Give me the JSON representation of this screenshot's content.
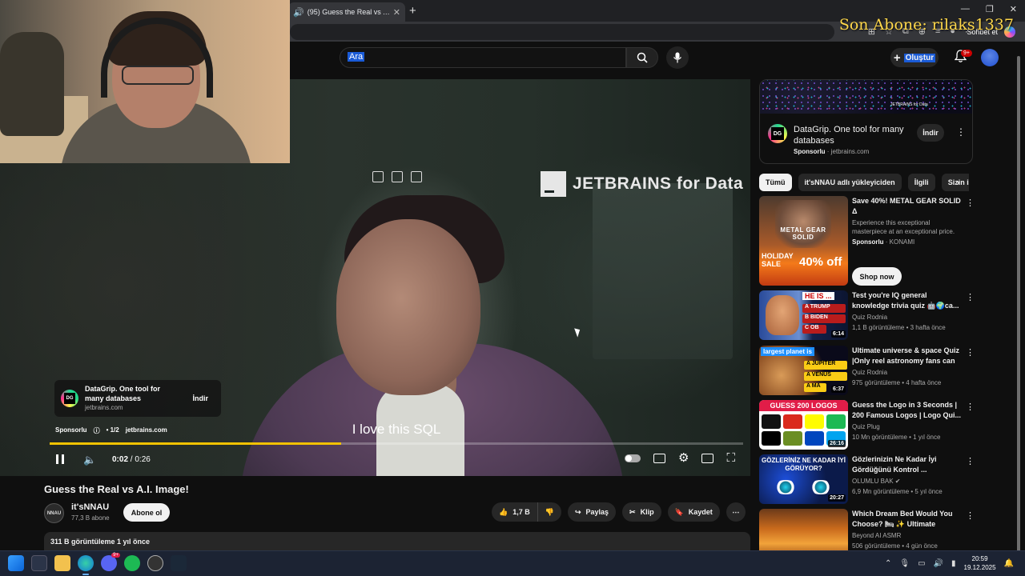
{
  "browser": {
    "tab_title": "(95) Guess the Real vs A.I. Image!",
    "sohbet_label": "Sohbet et",
    "overlay_text": "Son Abone: rilaks1337"
  },
  "header": {
    "search_placeholder": "Ara",
    "create_label": "Oluştur",
    "notif_count": "9+"
  },
  "player": {
    "brand_text": "JETBRAINS for Data",
    "subtitle": "I love this SQL",
    "ad": {
      "logo": "DG",
      "title": "DataGrip. One tool for many databases",
      "domain": "jetbrains.com",
      "button": "İndir"
    },
    "sponsor": {
      "label": "Sponsorlu",
      "count": "• 1/2",
      "domain": "jetbrains.com"
    },
    "time_current": "0:02",
    "time_total": "/ 0:26",
    "progress": 0.42
  },
  "video": {
    "title": "Guess the Real vs A.I. Image!",
    "channel_avatar": "NNAU",
    "channel": "it'sNNAU",
    "subs": "77,3 B abone",
    "subscribe": "Abone ol",
    "likes": "1,7 B",
    "share": "Paylaş",
    "clip": "Klip",
    "save": "Kaydet",
    "views_line": "311 B görüntüleme  1 yıl önce"
  },
  "side_ad": {
    "brand_small": "JETBRAINS for Data",
    "logo": "DG",
    "title": "DataGrip. One tool for many databases",
    "sponsor": "Sponsorlu",
    "domain": "· jetbrains.com",
    "button": "İndir"
  },
  "chips": [
    "Tümü",
    "it'sNNAU adlı yükleyiciden",
    "İlgili",
    "Sizin için"
  ],
  "rec_ad": {
    "title": "Save 40%! METAL GEAR SOLID Δ",
    "desc": "Experience this exceptional masterpiece at an exceptional price.",
    "sponsor": "Sponsorlu",
    "advertiser": "· KONAMI",
    "button": "Shop now",
    "thumb_title": "METAL GEAR SOLID",
    "thumb_sale": "HOLIDAY SALE",
    "thumb_pct": "40% off"
  },
  "recommendations": [
    {
      "title": "Test you're IQ general knowledge trivia quiz 🤖🌍ca...",
      "channel": "Quiz Rodnia",
      "meta": "1,1 B görüntüleme • 3 hafta önce",
      "duration": "6:14",
      "thumb": {
        "tag": "HE IS ...",
        "opts": [
          "A TRUMP",
          "B BIDEN",
          "C OB"
        ]
      }
    },
    {
      "title": "Ultimate universe & space Quiz |Only reel astronomy fans can ...",
      "channel": "Quiz Rodnia",
      "meta": "975 görüntüleme • 4 hafta önce",
      "duration": "6:37",
      "thumb": {
        "tag": "largest planet is",
        "opts": [
          "A JUPITER",
          "A VENUS",
          "A MA"
        ]
      }
    },
    {
      "title": "Guess the Logo in 3 Seconds | 200 Famous Logos | Logo Qui...",
      "channel": "Quiz Plug",
      "meta": "10 Mn görüntüleme • 1 yıl önce",
      "duration": "26:16",
      "thumb": {
        "tag": "GUESS 200 LOGOS"
      }
    },
    {
      "title": "Gözlerinizin Ne Kadar İyi Gördüğünü Kontrol ...",
      "channel": "OLUMLU BAK ✔",
      "meta": "6,9 Mn görüntüleme • 5 yıl önce",
      "duration": "20:27",
      "thumb": {
        "tag": "GÖZLERİNİZ NE KADAR İYİ GÖRÜYOR?"
      }
    },
    {
      "title": "Which Dream Bed Would You Choose? 🛏 ✨ Ultimate Oddly...",
      "channel": "Beyond AI ASMR",
      "meta": "506 görüntüleme • 4 gün önce",
      "duration": "",
      "thumb": {
        "tag": ""
      }
    }
  ],
  "taskbar": {
    "time": "20:59",
    "date": "19.12.2025",
    "discord_badge": "9+"
  }
}
